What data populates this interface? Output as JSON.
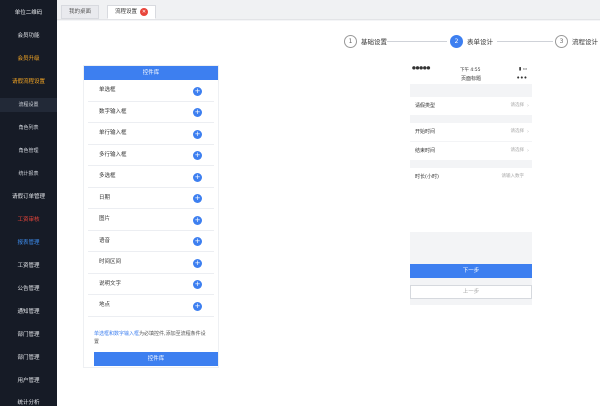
{
  "sidebar": {
    "items": [
      {
        "label": "单位二维码",
        "style": "normal"
      },
      {
        "label": "会员功能",
        "style": "normal"
      },
      {
        "label": "会员升级",
        "style": "orange"
      },
      {
        "label": "请假流程设置",
        "style": "orange"
      },
      {
        "label": "流程设置",
        "style": "orange-sub"
      },
      {
        "label": "角色列表",
        "style": "sub"
      },
      {
        "label": "角色管理",
        "style": "sub"
      },
      {
        "label": "统计报表",
        "style": "sub"
      },
      {
        "label": "请假订单管理",
        "style": "normal"
      },
      {
        "label": "工资审核",
        "style": "red"
      },
      {
        "label": "报表管理",
        "style": "blue"
      },
      {
        "label": "工资管理",
        "style": "normal"
      },
      {
        "label": "公告管理",
        "style": "normal"
      },
      {
        "label": "通知管理",
        "style": "normal"
      },
      {
        "label": "部门管理",
        "style": "normal"
      },
      {
        "label": "部门管理",
        "style": "normal"
      },
      {
        "label": "用户管理",
        "style": "normal"
      },
      {
        "label": "统计分析",
        "style": "normal"
      }
    ],
    "collapse_glyph": "‹"
  },
  "tabs": [
    {
      "label": "我的桌面"
    },
    {
      "label": "流程设置",
      "close_glyph": "✕"
    }
  ],
  "steps": [
    {
      "number": "1",
      "label": "基础设置"
    },
    {
      "number": "2",
      "label": "表单设计"
    },
    {
      "number": "3",
      "label": "流程设计"
    }
  ],
  "library": {
    "header": "控件库",
    "items": [
      {
        "label": "单选框"
      },
      {
        "label": "数字输入框"
      },
      {
        "label": "单行输入框"
      },
      {
        "label": "多行输入框"
      },
      {
        "label": "多选框"
      },
      {
        "label": "日期"
      },
      {
        "label": "图片"
      },
      {
        "label": "语音"
      },
      {
        "label": "时间区间"
      },
      {
        "label": "说明文字"
      },
      {
        "label": "地点"
      }
    ],
    "plus_glyph": "+",
    "note_highlight": "单选框和数字输入框",
    "note_text": "为必填控件,添加至流程条件设置",
    "footer": "控件库"
  },
  "phone": {
    "signal": "●●●●●",
    "time": "下午 4:55",
    "battery": "▮ ▭",
    "title": "页面标题",
    "more": "•••",
    "rows": [
      {
        "label": "请假类型",
        "value": "请选择"
      },
      {
        "label": "开始时间",
        "value": "请选择"
      },
      {
        "label": "结束时间",
        "value": "请选择"
      },
      {
        "label": "时长(小时)",
        "value": "请输入数字"
      }
    ],
    "chevron": "›",
    "next_button": "下一步",
    "prev_button": "上一步"
  }
}
